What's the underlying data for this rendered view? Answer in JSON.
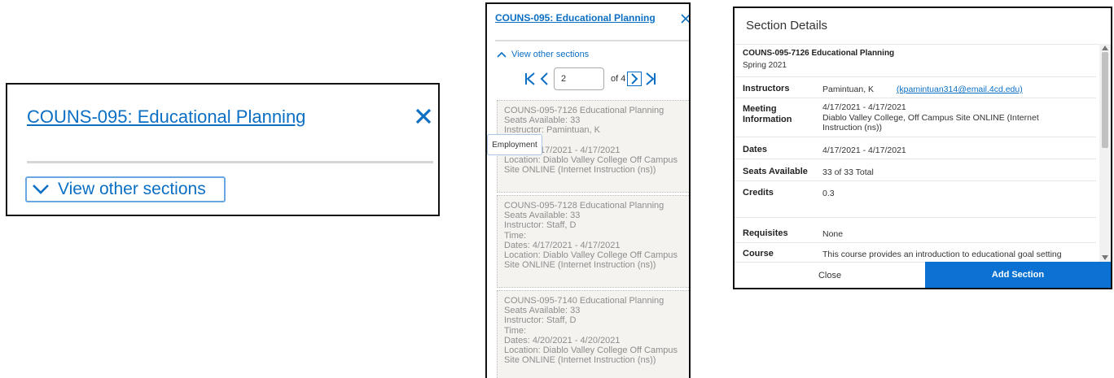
{
  "colors": {
    "link": "#0b6fc4",
    "primary_button": "#0b72d4",
    "card_bg": "#f5f3ef"
  },
  "zoom_panel": {
    "course_title": "COUNS-095: Educational Planning",
    "toggle_label": "View other sections",
    "icons": [
      "close-icon",
      "chevron-down-icon"
    ]
  },
  "list_panel": {
    "course_title": "COUNS-095: Educational Planning",
    "toggle_label": "View other sections",
    "pager": {
      "page_value": "2",
      "of_label": "of 4"
    },
    "tooltip": "Employment",
    "sections": [
      {
        "lines": [
          "COUNS-095-7126 Educational Planning",
          "Seats Available: 33",
          "Instructor: Pamintuan, K",
          "Time:",
          "Dates: 4/17/2021 - 4/17/2021",
          "Location: Diablo Valley College Off Campus",
          "Site ONLINE (Internet Instruction (ns))"
        ]
      },
      {
        "lines": [
          "COUNS-095-7128 Educational Planning",
          "Seats Available: 33",
          "Instructor: Staff, D",
          "Time:",
          "Dates: 4/17/2021 - 4/17/2021",
          "Location: Diablo Valley College Off Campus",
          "Site ONLINE (Internet Instruction (ns))"
        ]
      },
      {
        "lines": [
          "COUNS-095-7140 Educational Planning",
          "Seats Available: 33",
          "Instructor: Staff, D",
          "Time:",
          "Dates: 4/20/2021 - 4/20/2021",
          "Location: Diablo Valley College Off Campus",
          "Site ONLINE (Internet Instruction (ns))"
        ]
      }
    ]
  },
  "details": {
    "header": "Section Details",
    "course": "COUNS-095-7126 Educational Planning",
    "term": "Spring 2021",
    "instructors_label": "Instructors",
    "instructor_name": "Pamintuan, K",
    "instructor_email": "(kpamintuan314@email.4cd.edu)",
    "meeting_label_1": "Meeting",
    "meeting_label_2": "Information",
    "meeting_line_1": "4/17/2021 - 4/17/2021",
    "meeting_line_2": "Diablo Valley College, Off Campus Site ONLINE (Internet Instruction (ns))",
    "dates_label": "Dates",
    "dates_value": "4/17/2021 - 4/17/2021",
    "seats_label": "Seats Available",
    "seats_value": "33 of 33 Total",
    "credits_label": "Credits",
    "credits_value": "0.3",
    "requisites_label": "Requisites",
    "requisites_value": "None",
    "course_desc_label": "Course",
    "course_desc_value": "This course provides an introduction to educational goal setting",
    "close_button": "Close",
    "add_button": "Add Section"
  }
}
